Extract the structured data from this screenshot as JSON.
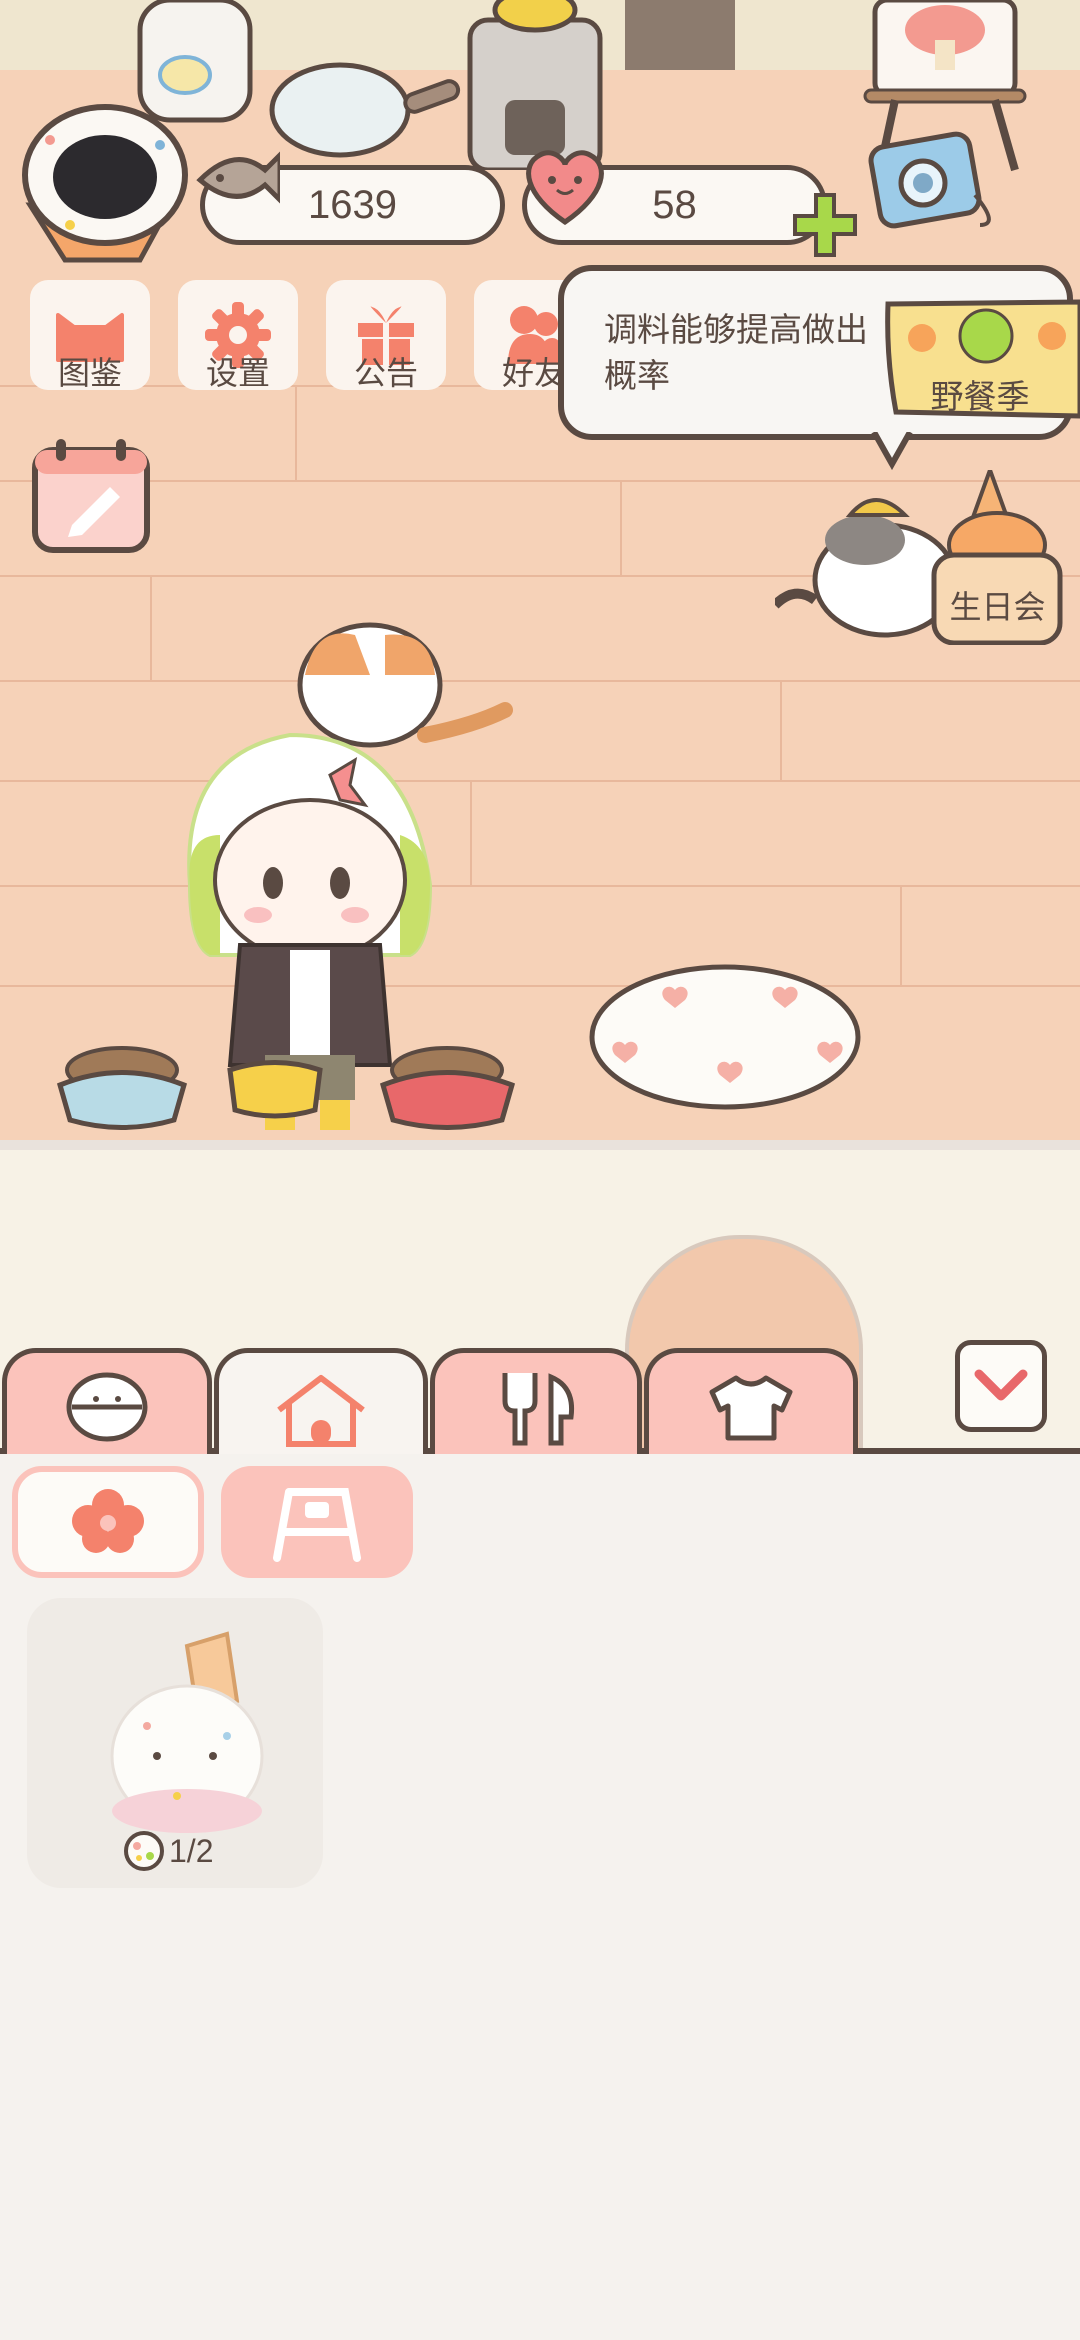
{
  "stats": {
    "fish_count": "1639",
    "heart_count": "58"
  },
  "menu": [
    {
      "label": "图鉴",
      "icon": "cat-face-icon"
    },
    {
      "label": "设置",
      "icon": "gear-icon"
    },
    {
      "label": "公告",
      "icon": "gift-icon"
    },
    {
      "label": "好友",
      "icon": "friends-icon"
    }
  ],
  "tip": {
    "text_line1": "调料能够提高做出",
    "text_line2": "概率"
  },
  "events": {
    "picnic_label": "野餐季",
    "birthday_label": "生日会"
  },
  "tabs": [
    {
      "name": "tab-food-bowl",
      "icon": "bowl-icon",
      "active": false
    },
    {
      "name": "tab-home",
      "icon": "house-icon",
      "active": true
    },
    {
      "name": "tab-cooking",
      "icon": "fork-knife-icon",
      "active": false
    },
    {
      "name": "tab-clothing",
      "icon": "shirt-icon",
      "active": false
    }
  ],
  "subtabs": [
    {
      "name": "subtab-flower",
      "icon": "flower-icon",
      "active": true
    },
    {
      "name": "subtab-sign",
      "icon": "signboard-icon",
      "active": false
    }
  ],
  "items": [
    {
      "name": "party-hat-cat-cushion",
      "count": "1/2"
    }
  ],
  "colors": {
    "accent_pink": "#fbc3bb",
    "outline": "#5a4a42",
    "salmon": "#f4826c",
    "green": "#a8d84a"
  }
}
